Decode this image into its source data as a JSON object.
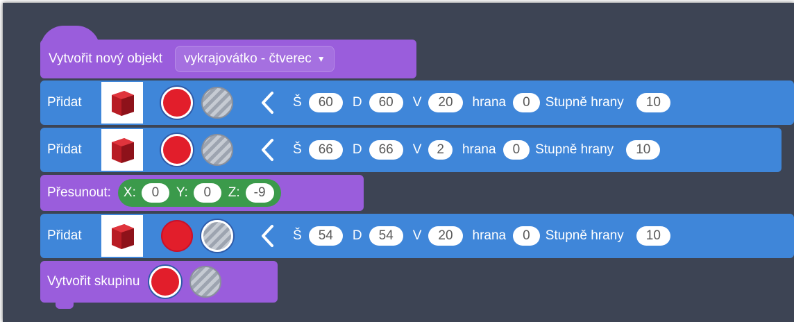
{
  "create_block": {
    "label": "Vytvořit nový objekt",
    "dropdown": "vykrajovátko - čtverec"
  },
  "add_blocks": [
    {
      "label": "Přidat",
      "color_selected": "red",
      "s_label": "Š",
      "s_value": "60",
      "d_label": "D",
      "d_value": "60",
      "v_label": "V",
      "v_value": "20",
      "edge_label": "hrana",
      "edge_value": "0",
      "degrees_label": "Stupně hrany",
      "degrees_value": "10"
    },
    {
      "label": "Přidat",
      "color_selected": "red",
      "s_label": "Š",
      "s_value": "66",
      "d_label": "D",
      "d_value": "66",
      "v_label": "V",
      "v_value": "2",
      "edge_label": "hrana",
      "edge_value": "0",
      "degrees_label": "Stupně hrany",
      "degrees_value": "10"
    },
    {
      "label": "Přidat",
      "color_selected": "gray",
      "s_label": "Š",
      "s_value": "54",
      "d_label": "D",
      "d_value": "54",
      "v_label": "V",
      "v_value": "20",
      "edge_label": "hrana",
      "edge_value": "0",
      "degrees_label": "Stupně hrany",
      "degrees_value": "10"
    }
  ],
  "move_block": {
    "label": "Přesunout:",
    "x_label": "X:",
    "x_value": "0",
    "y_label": "Y:",
    "y_value": "0",
    "z_label": "Z:",
    "z_value": "-9"
  },
  "group_block": {
    "label": "Vytvořit skupinu",
    "color_selected": "red"
  },
  "colors": {
    "workspace": "#3d4454",
    "purple_block": "#9a5ddc",
    "blue_block": "#3f86d9",
    "green_block": "#3b9a4b",
    "red_swatch": "#e21e2b"
  },
  "icons": {
    "thumbnail": "red-cube-icon",
    "back": "chevron-left-icon",
    "dropdown": "caret-down-icon"
  }
}
